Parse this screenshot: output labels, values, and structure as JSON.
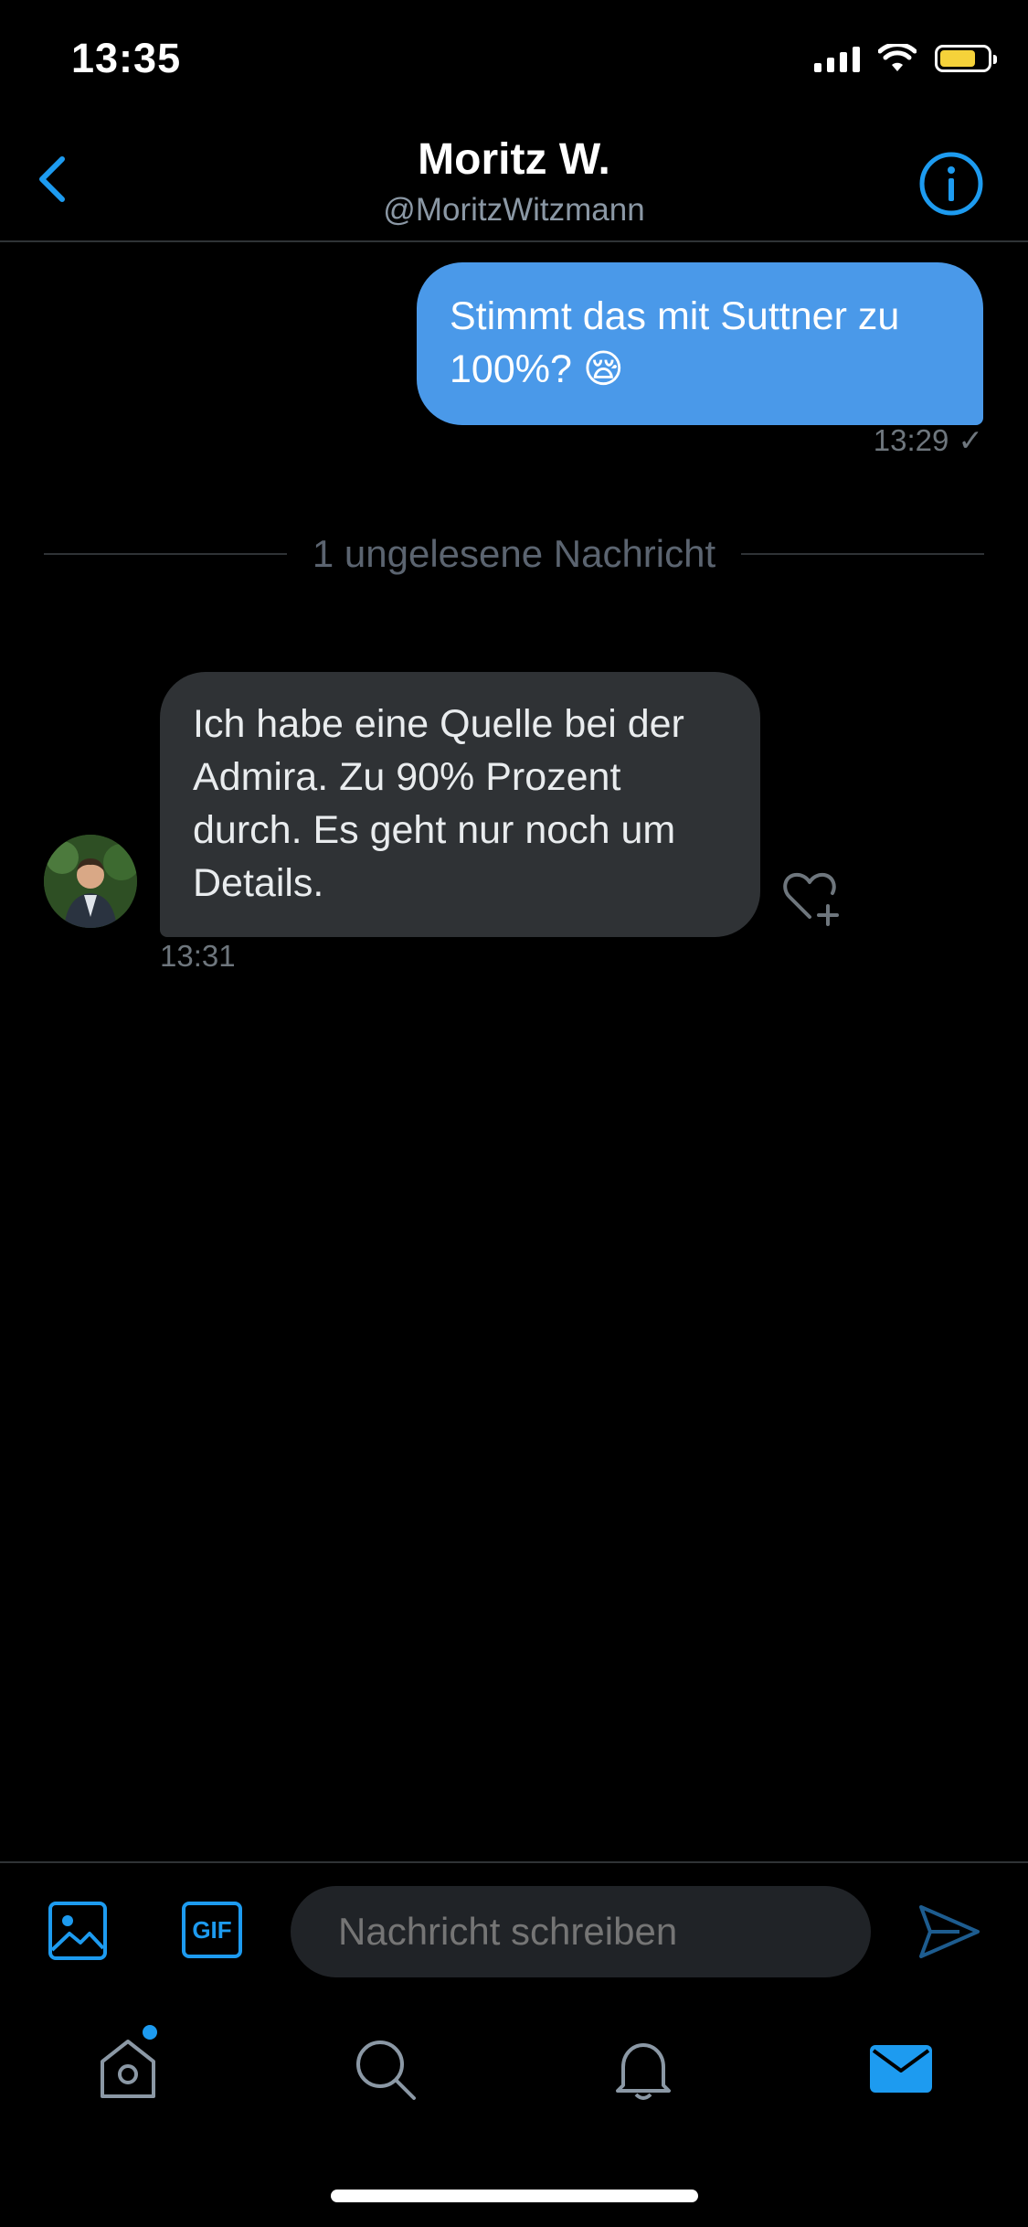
{
  "status_bar": {
    "time": "13:35"
  },
  "header": {
    "name": "Moritz W.",
    "handle": "@MoritzWitzmann"
  },
  "messages": [
    {
      "direction": "outgoing",
      "text": "Stimmt das mit Suttner zu 100%? 😪",
      "time": "13:29",
      "status": "✓"
    },
    {
      "direction": "incoming",
      "text": "Ich habe eine Quelle bei der Admira. Zu 90% Prozent durch. Es geht nur noch um Details.",
      "time": "13:31"
    }
  ],
  "unread_divider": "1 ungelesene Nachricht",
  "composer": {
    "gif_label": "GIF",
    "placeholder": "Nachricht schreiben"
  },
  "tabs": [
    {
      "name": "home",
      "icon": "home-icon",
      "badge": true
    },
    {
      "name": "search",
      "icon": "search-icon"
    },
    {
      "name": "notifications",
      "icon": "bell-icon"
    },
    {
      "name": "messages",
      "icon": "mail-icon",
      "active": true
    }
  ],
  "colors": {
    "accent": "#1d9bf0",
    "outgoing_bubble": "#4a99e9",
    "incoming_bubble": "#2f3235",
    "background": "#000000"
  }
}
